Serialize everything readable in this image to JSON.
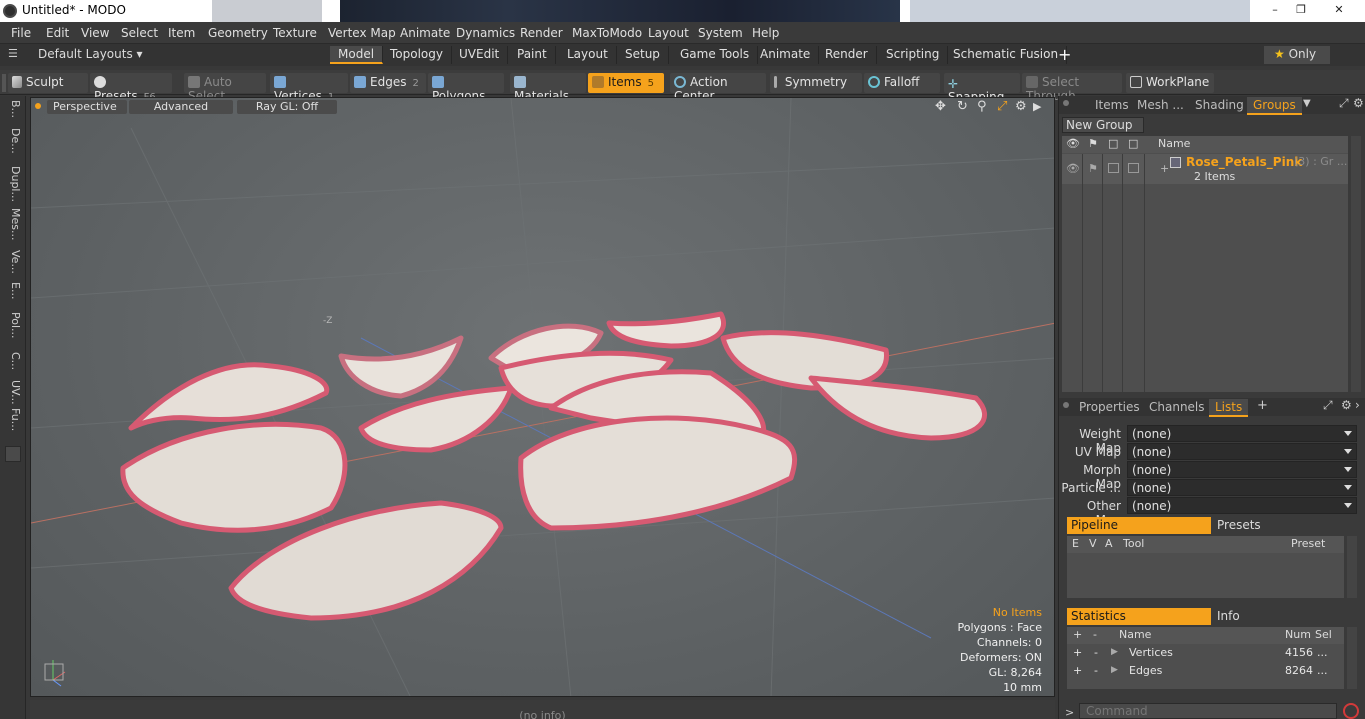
{
  "titlebar": {
    "title": "Untitled* - MODO",
    "minimize": "–",
    "maximize": "❐",
    "close": "✕"
  },
  "menu": [
    "File",
    "Edit",
    "View",
    "Select",
    "Item",
    "Geometry",
    "Texture",
    "Vertex Map",
    "Animate",
    "Dynamics",
    "Render",
    "MaxToModo",
    "Layout",
    "System",
    "Help"
  ],
  "layouts": {
    "dropdown": "Default Layouts",
    "tabs": [
      "Model",
      "Topology",
      "UVEdit",
      "Paint",
      "Layout",
      "Setup",
      "Game Tools",
      "Animate",
      "Render",
      "Scripting",
      "Schematic Fusion"
    ],
    "active_tab": "Model",
    "add": "+",
    "only": "Only"
  },
  "toolbar": {
    "sculpt": "Sculpt",
    "presets": "Presets",
    "presets_key": "F6",
    "auto_select": "Auto Select",
    "vertices": "Vertices",
    "vertices_num": "1",
    "edges": "Edges",
    "edges_num": "2",
    "polygons": "Polygons",
    "materials": "Materials",
    "items": "Items",
    "items_num": "5",
    "action_center": "Action Center",
    "symmetry": "Symmetry",
    "falloff": "Falloff",
    "snapping": "Snapping",
    "select_through": "Select Through",
    "workplane": "WorkPlane"
  },
  "left_tabs": [
    "B...",
    "De...",
    "Dupl...",
    "Mes...",
    "Ve...",
    "E...",
    "Pol...",
    "C...",
    "UV...",
    "Fu..."
  ],
  "viewport": {
    "perspective": "Perspective",
    "advanced": "Advanced",
    "raygl": "Ray GL: Off",
    "axis_label": "-Z",
    "info": {
      "no_items": "No Items",
      "polygons": "Polygons : Face",
      "channels": "Channels: 0",
      "deformers": "Deformers: ON",
      "gl": "GL: 8,264",
      "scale": "10 mm"
    }
  },
  "statusbar": {
    "text": "(no info)"
  },
  "colors": {
    "accent": "#f5a21c",
    "petal": "#e6dfd8",
    "petal_edge": "#d65a72"
  },
  "groups_panel": {
    "tabs": [
      "Items",
      "Mesh ...",
      "Shading",
      "Groups"
    ],
    "active_tab": "Groups",
    "new_group": "New Group",
    "col_name": "Name",
    "group_name": "Rose_Petals_Pink",
    "group_suffix": "(3) : Gr ...",
    "group_items": "2 Items"
  },
  "props_panel": {
    "tabs": [
      "Properties",
      "Channels",
      "Lists"
    ],
    "active_tab": "Lists",
    "add": "+",
    "fields": [
      {
        "label": "Weight Map",
        "value": "(none)"
      },
      {
        "label": "UV Map",
        "value": "(none)"
      },
      {
        "label": "Morph Map",
        "value": "(none)"
      },
      {
        "label": "Particle ...",
        "value": "(none)"
      },
      {
        "label": "Other Map",
        "value": "(none)"
      }
    ],
    "pipeline": "Pipeline",
    "presets": "Presets",
    "pipeline_cols": [
      "E",
      "V",
      "A",
      "Tool",
      "Preset"
    ],
    "statistics": "Statistics",
    "info": "Info",
    "stats_cols": [
      "+",
      "-",
      "Name",
      "Num",
      "Sel"
    ],
    "stats_rows": [
      {
        "plus": "+",
        "minus": "-",
        "name": "Vertices",
        "num": "4156",
        "sel": "..."
      },
      {
        "plus": "+",
        "minus": "-",
        "name": "Edges",
        "num": "8264",
        "sel": "..."
      }
    ]
  },
  "command": {
    "prompt": ">",
    "placeholder": "Command"
  }
}
